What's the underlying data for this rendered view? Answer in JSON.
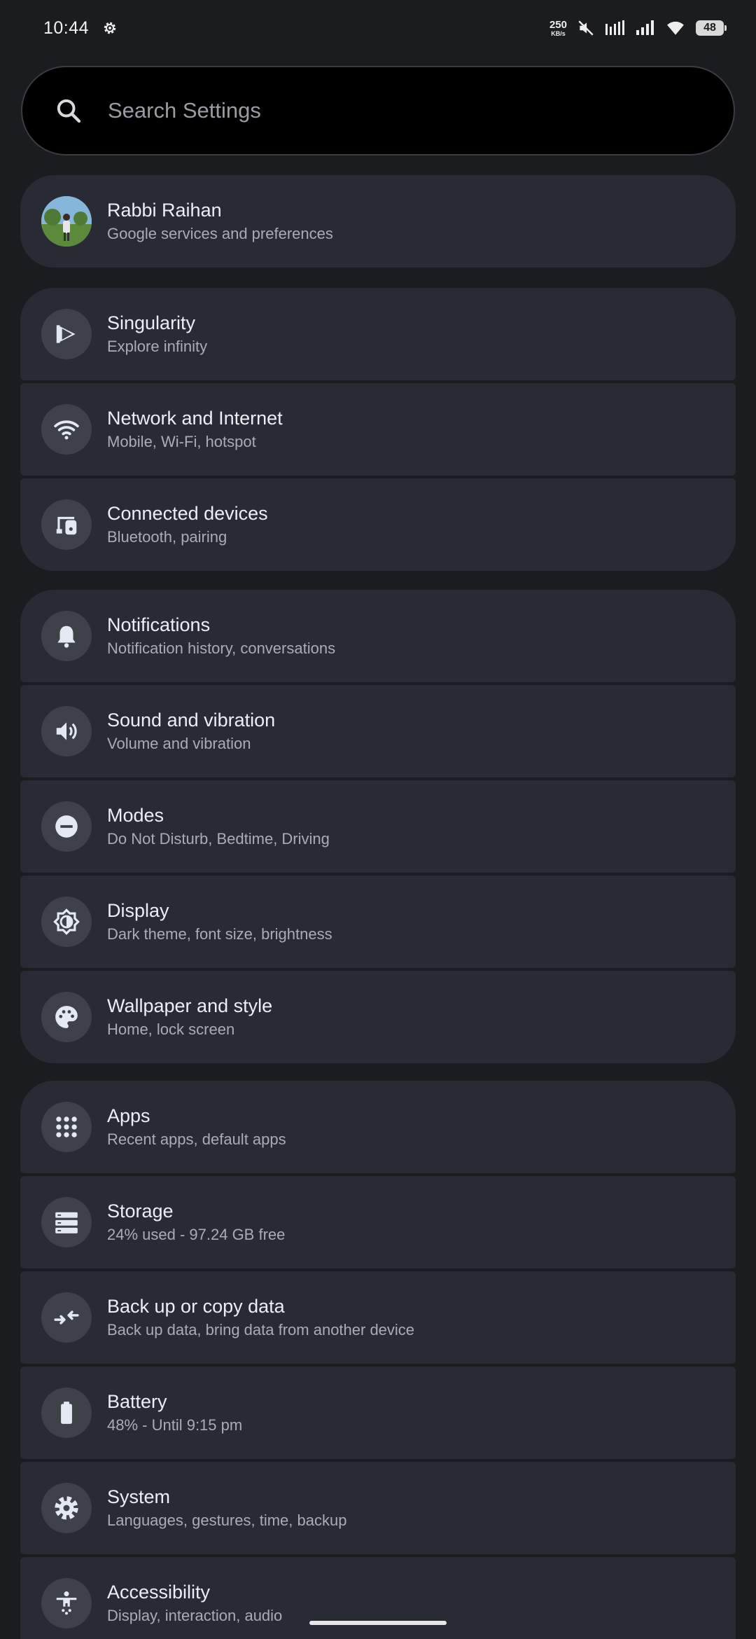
{
  "status_bar": {
    "time": "10:44",
    "net_speed_value": "250",
    "net_speed_unit": "KB/s",
    "battery_level": "48"
  },
  "search": {
    "placeholder": "Search Settings"
  },
  "account": {
    "name": "Rabbi Raihan",
    "subtitle": "Google services and preferences"
  },
  "group1": [
    {
      "title": "Singularity",
      "subtitle": "Explore infinity",
      "icon": "singularity-icon"
    },
    {
      "title": "Network and Internet",
      "subtitle": "Mobile, Wi-Fi, hotspot",
      "icon": "wifi-icon"
    },
    {
      "title": "Connected devices",
      "subtitle": "Bluetooth, pairing",
      "icon": "devices-icon"
    }
  ],
  "group2": [
    {
      "title": "Notifications",
      "subtitle": "Notification history, conversations",
      "icon": "bell-icon"
    },
    {
      "title": "Sound and vibration",
      "subtitle": "Volume and vibration",
      "icon": "speaker-icon"
    },
    {
      "title": "Modes",
      "subtitle": "Do Not Disturb, Bedtime, Driving",
      "icon": "do-not-disturb-icon"
    },
    {
      "title": "Display",
      "subtitle": "Dark theme, font size, brightness",
      "icon": "brightness-icon"
    },
    {
      "title": "Wallpaper and style",
      "subtitle": "Home, lock screen",
      "icon": "palette-icon"
    }
  ],
  "group3": [
    {
      "title": "Apps",
      "subtitle": "Recent apps, default apps",
      "icon": "apps-grid-icon"
    },
    {
      "title": "Storage",
      "subtitle": "24% used - 97.24 GB free",
      "icon": "storage-icon"
    },
    {
      "title": "Back up or copy data",
      "subtitle": "Back up data, bring data from another device",
      "icon": "transfer-icon"
    },
    {
      "title": "Battery",
      "subtitle": "48% - Until 9:15 pm",
      "icon": "battery-icon"
    },
    {
      "title": "System",
      "subtitle": "Languages, gestures, time, backup",
      "icon": "gear-icon"
    },
    {
      "title": "Accessibility",
      "subtitle": "Display, interaction, audio",
      "icon": "accessibility-icon"
    }
  ],
  "colors": {
    "background": "#1a1c20",
    "card": "#282b33",
    "icon_circle": "#3f4149",
    "icon_fill": "#e4e8f2"
  }
}
